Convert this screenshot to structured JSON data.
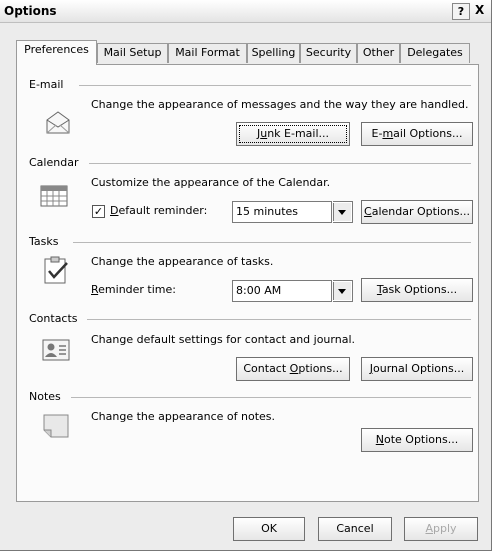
{
  "window": {
    "title": "Options",
    "help_label": "?",
    "close_label": "X"
  },
  "tabs": [
    {
      "label": "Preferences",
      "active": true
    },
    {
      "label": "Mail Setup",
      "active": false
    },
    {
      "label": "Mail Format",
      "active": false
    },
    {
      "label": "Spelling",
      "active": false
    },
    {
      "label": "Security",
      "active": false
    },
    {
      "label": "Other",
      "active": false
    },
    {
      "label": "Delegates",
      "active": false
    }
  ],
  "email": {
    "header": "E-mail",
    "description": "Change the appearance of messages and the way they are handled.",
    "junk_button": {
      "pre": "J",
      "key": "u",
      "post": "nk E-mail..."
    },
    "options_button": {
      "pre": "E-",
      "key": "m",
      "post": "ail Options..."
    }
  },
  "calendar": {
    "header": "Calendar",
    "description": "Customize the appearance of the Calendar.",
    "default_reminder": {
      "pre": "",
      "key": "D",
      "post": "efault reminder:",
      "checked": true,
      "check_glyph": "✓"
    },
    "reminder_value": "15 minutes",
    "options_button": {
      "pre": "",
      "key": "C",
      "post": "alendar Options..."
    }
  },
  "tasks": {
    "header": "Tasks",
    "description": "Change the appearance of tasks.",
    "reminder_time": {
      "pre": "",
      "key": "R",
      "post": "eminder time:"
    },
    "reminder_value": "8:00 AM",
    "options_button": {
      "pre": "",
      "key": "T",
      "post": "ask Options..."
    }
  },
  "contacts": {
    "header": "Contacts",
    "description": "Change default settings for contact and journal.",
    "contact_button": {
      "pre": "Contact ",
      "key": "O",
      "post": "ptions..."
    },
    "journal_button": {
      "pre": "",
      "key": "J",
      "post": "ournal Options..."
    }
  },
  "notes": {
    "header": "Notes",
    "description": "Change the appearance of notes.",
    "options_button": {
      "pre": "",
      "key": "N",
      "post": "ote Options..."
    }
  },
  "footer": {
    "ok_label": "OK",
    "cancel_label": "Cancel",
    "apply": {
      "pre": "",
      "key": "A",
      "post": "pply"
    }
  }
}
